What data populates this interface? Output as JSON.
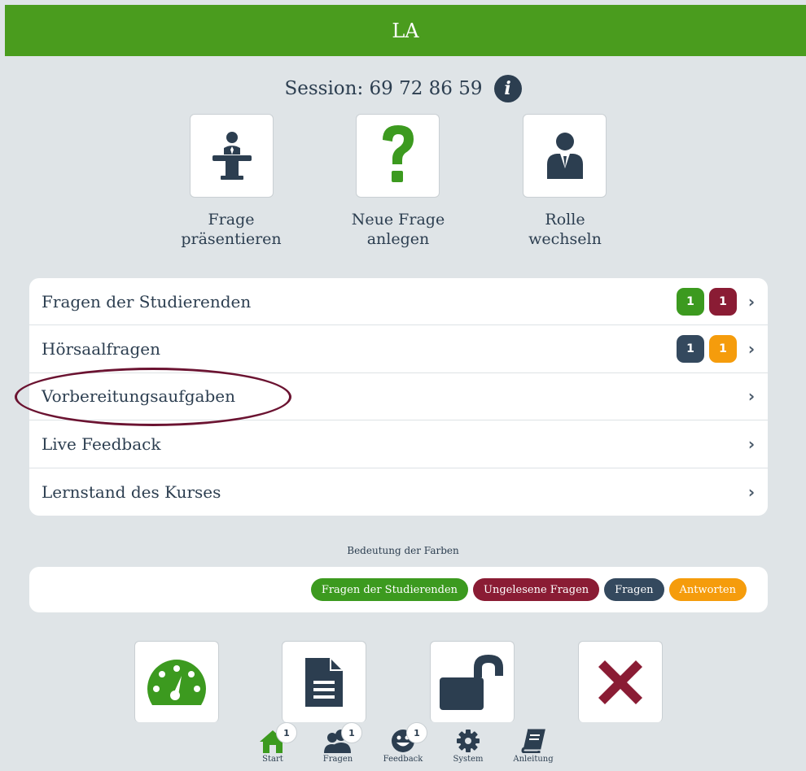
{
  "header": {
    "title": "LA"
  },
  "session": {
    "text": "Session: 69 72 86 59",
    "info_glyph": "i"
  },
  "tiles": [
    {
      "line1": "Frage",
      "line2": "präsentieren",
      "icon": "lectern-presenter-icon"
    },
    {
      "line1": "Neue Frage",
      "line2": "anlegen",
      "icon": "question-mark-icon"
    },
    {
      "line1": "Rolle",
      "line2": "wechseln",
      "icon": "user-suit-icon"
    }
  ],
  "menu": [
    {
      "label": "Fragen der Studierenden",
      "badges": [
        {
          "value": "1",
          "color": "#3c9a1f"
        },
        {
          "value": "1",
          "color": "#8a1c34"
        }
      ]
    },
    {
      "label": "Hörsaalfragen",
      "badges": [
        {
          "value": "1",
          "color": "#34495e"
        },
        {
          "value": "1",
          "color": "#f59c0c"
        }
      ]
    },
    {
      "label": "Vorbereitungsaufgaben",
      "badges": []
    },
    {
      "label": "Live Feedback",
      "badges": []
    },
    {
      "label": "Lernstand des Kurses",
      "badges": []
    }
  ],
  "chevron": "›",
  "legend": {
    "title": "Bedeutung der Farben",
    "items": [
      {
        "label": "Fragen der Studierenden",
        "color": "#3c9a1f"
      },
      {
        "label": "Ungelesene Fragen",
        "color": "#8a1c34"
      },
      {
        "label": "Fragen",
        "color": "#34495e"
      },
      {
        "label": "Antworten",
        "color": "#f59c0c"
      }
    ]
  },
  "bottom_tiles": [
    "speedometer-icon",
    "document-icon",
    "unlock-icon",
    "close-x-icon"
  ],
  "tabbar": [
    {
      "label": "Start",
      "badge": "1",
      "icon": "home-icon"
    },
    {
      "label": "Fragen",
      "badge": "1",
      "icon": "users-icon"
    },
    {
      "label": "Feedback",
      "badge": "1",
      "icon": "smiley-icon"
    },
    {
      "label": "System",
      "badge": "",
      "icon": "gear-icon"
    },
    {
      "label": "Anleitung",
      "badge": "",
      "icon": "book-icon"
    }
  ],
  "colors": {
    "header": "#4a9c1e",
    "text": "#2c3e50",
    "background": "#dfe4e7",
    "highlight_ring": "#6b1331"
  }
}
